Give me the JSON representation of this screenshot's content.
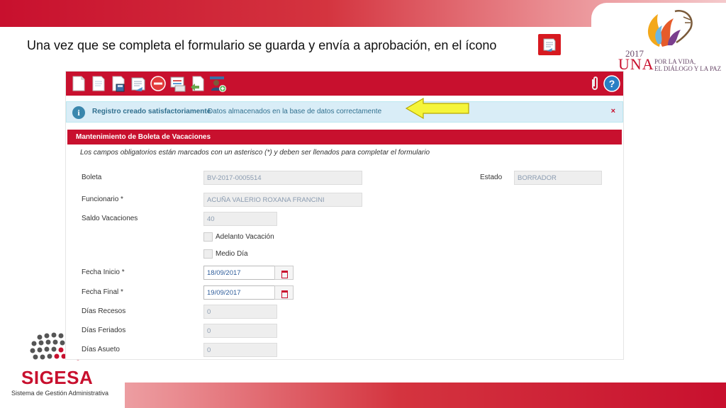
{
  "slide": {
    "headline": "Una vez que se completa el formulario se guarda y envía a aprobación, en el ícono",
    "una_logo": {
      "year": "2017",
      "word": "UNA",
      "tagline_1": "POR LA VIDA,",
      "tagline_2": "EL DIÁLOGO Y LA PAZ"
    },
    "sigesa_logo": {
      "name": "SIGESA",
      "subtitle": "Sistema de Gestión Administrativa"
    }
  },
  "toolbar": {
    "icons": [
      "new-document-icon",
      "copy-document-icon",
      "save-icon",
      "send-approval-icon",
      "delete-icon",
      "report-icon",
      "export-icon",
      "user-add-icon",
      "attachment-icon",
      "help-icon"
    ]
  },
  "notice": {
    "title": "Registro creado satisfactoriamente",
    "message": "Datos almacenados en la base de datos correctamente",
    "close": "×"
  },
  "form": {
    "title": "Mantenimiento de Boleta de Vacaciones",
    "note": "Los campos obligatorios están marcados con un asterisco (*) y deben ser llenados para completar el formulario",
    "boleta_label": "Boleta",
    "boleta_value": "BV-2017-0005514",
    "estado_label": "Estado",
    "estado_value": "BORRADOR",
    "funcionario_label": "Funcionario  *",
    "funcionario_value": "ACUÑA  VALERIO ROXANA FRANCINI",
    "saldo_label": "Saldo Vacaciones",
    "saldo_value": "40",
    "adelanto_label": "Adelanto Vacación",
    "medio_dia_label": "Medio Día",
    "fecha_inicio_label": "Fecha Inicio  *",
    "fecha_inicio_value": "18/09/2017",
    "fecha_final_label": "Fecha Final  *",
    "fecha_final_value": "19/09/2017",
    "recesos_label": "Días Recesos",
    "recesos_value": "0",
    "feriados_label": "Días Feriados",
    "feriados_value": "0",
    "asueto_label": "Días Asueto",
    "asueto_value": "0"
  },
  "colors": {
    "brand_red": "#c8102e",
    "notice_bg": "#d9edf7",
    "notice_text": "#31708f",
    "arrow_yellow": "#f5f53a"
  }
}
